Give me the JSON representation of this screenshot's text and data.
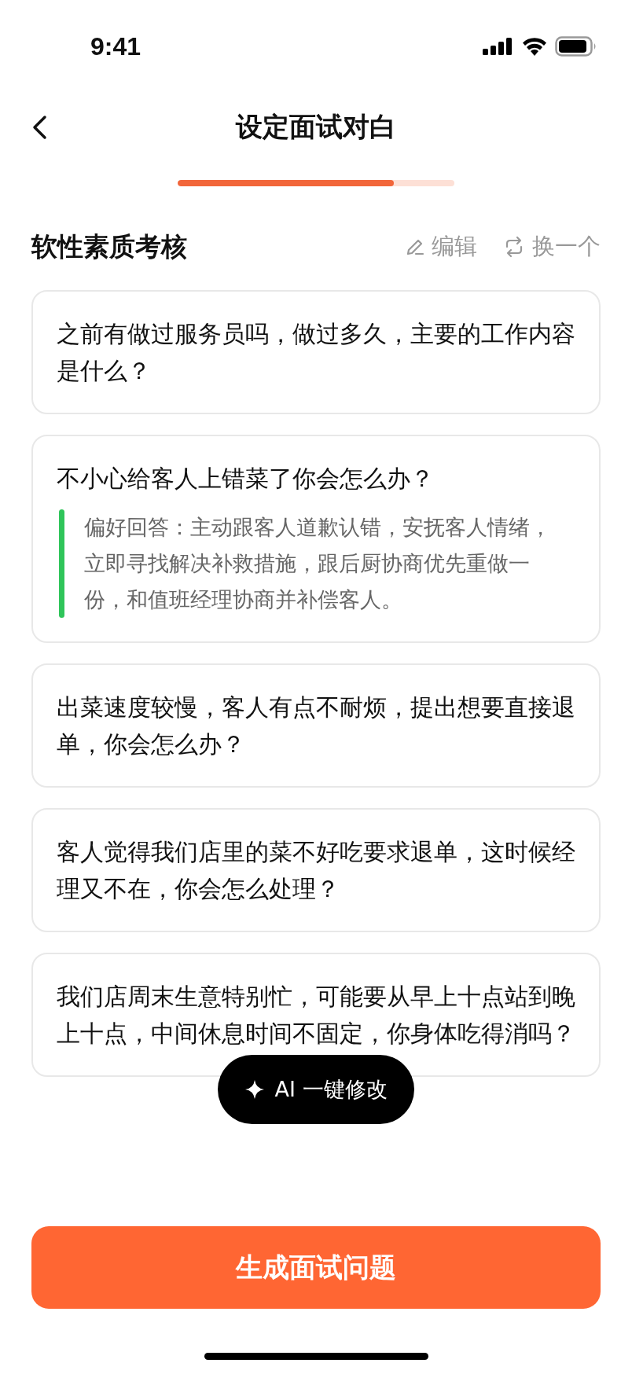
{
  "status_bar": {
    "time": "9:41"
  },
  "header": {
    "title": "设定面试对白"
  },
  "progress": {
    "level": 0.78
  },
  "section": {
    "title": "软性素质考核",
    "actions": [
      {
        "kind": "edit",
        "label": "编辑"
      },
      {
        "kind": "refresh",
        "label": "换一个"
      }
    ]
  },
  "questions": [
    {
      "text": "之前有做过服务员吗，做过多久，主要的工作内容是什么？"
    },
    {
      "text": "不小心给客人上错菜了你会怎么办？",
      "preferred_answer": "偏好回答：主动跟客人道歉认错，安抚客人情绪，立即寻找解决补救措施，跟后厨协商优先重做一份，和值班经理协商并补偿客人。"
    },
    {
      "text": "出菜速度较慢，客人有点不耐烦，提出想要直接退单，你会怎么办？"
    },
    {
      "text": "客人觉得我们店里的菜不好吃要求退单，这时候经理又不在，你会怎么处理？"
    },
    {
      "text": "我们店周末生意特别忙，可能要从早上十点站到晚上十点，中间休息时间不固定，你身体吃得消吗？"
    }
  ],
  "ai_button": {
    "label": "AI 一键修改"
  },
  "submit_button": {
    "label": "生成面试问题"
  }
}
